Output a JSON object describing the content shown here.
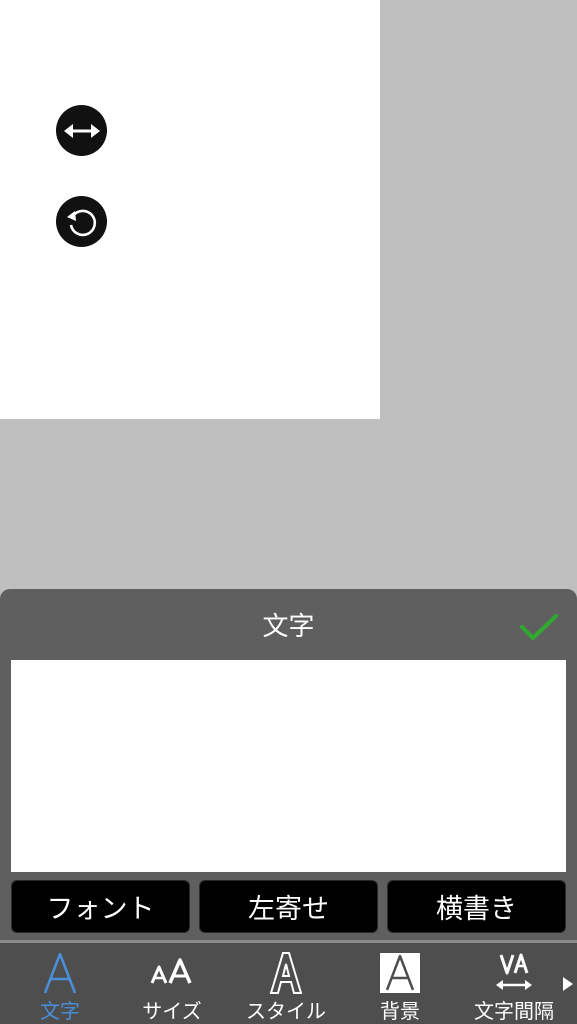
{
  "panel": {
    "title": "文字",
    "text_value": ""
  },
  "options": [
    {
      "label": "フォント"
    },
    {
      "label": "左寄せ"
    },
    {
      "label": "横書き"
    }
  ],
  "tabs": [
    {
      "label": "文字",
      "icon": "letter-a-icon",
      "active": true
    },
    {
      "label": "サイズ",
      "icon": "font-size-icon",
      "active": false
    },
    {
      "label": "スタイル",
      "icon": "outline-letter-icon",
      "active": false
    },
    {
      "label": "背景",
      "icon": "background-letter-icon",
      "active": false
    },
    {
      "label": "文字間隔",
      "icon": "letter-spacing-icon",
      "active": false
    }
  ],
  "colors": {
    "active_tab": "#4a90d9",
    "confirm": "#2faa2f",
    "panel_bg": "#5f5f5f"
  }
}
